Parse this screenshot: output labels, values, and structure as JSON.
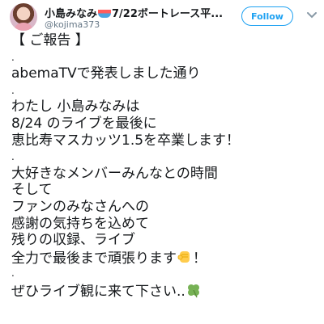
{
  "header": {
    "display_name_prefix": "小島みなみ",
    "display_name_suffix": "7/22ボートレース平...",
    "handle": "@kojima373",
    "follow_label": "Follow",
    "boat_icon": "boat-emoji-icon"
  },
  "tweet": {
    "lines": [
      "【 ご報告 】",
      ".",
      "abemaTVで発表しました通り",
      ".",
      "わたし 小島みなみは",
      "8/24 のライブを最後に",
      "恵比寿マスカッツ1.5を卒業します！",
      ".",
      "大好きなメンバーみんなとの時間",
      "そして",
      "ファンのみなさんへの",
      "感謝の気持ちを込めて",
      "残りの収録、ライブ",
      "全力で最後まで頑張ります",
      "！",
      ".",
      "ぜひライブ観に来て下さい.."
    ],
    "fist_icon": "raised-fist-emoji-icon",
    "clover_icon": "four-leaf-clover-emoji-icon"
  },
  "colors": {
    "accent": "#1da1f2",
    "text": "#14171a",
    "muted": "#657786"
  }
}
